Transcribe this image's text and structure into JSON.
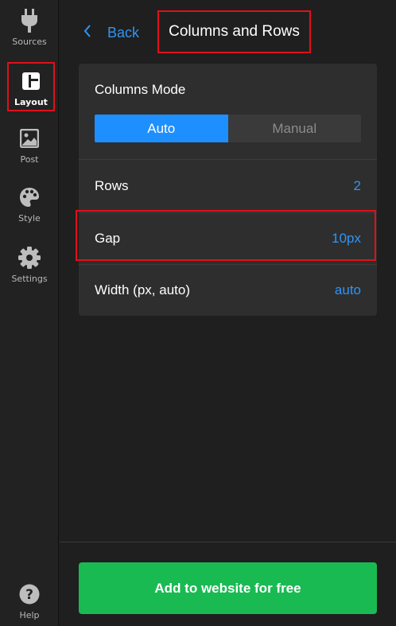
{
  "sidebar": {
    "items": [
      {
        "label": "Sources",
        "icon": "plug-icon"
      },
      {
        "label": "Layout",
        "icon": "layout-icon",
        "active": true
      },
      {
        "label": "Post",
        "icon": "image-icon"
      },
      {
        "label": "Style",
        "icon": "palette-icon"
      },
      {
        "label": "Settings",
        "icon": "gear-icon"
      }
    ],
    "help_label": "Help"
  },
  "header": {
    "back_label": "Back",
    "title": "Columns and Rows"
  },
  "columns_mode": {
    "title": "Columns Mode",
    "options": [
      "Auto",
      "Manual"
    ],
    "selected": "Auto"
  },
  "settings": {
    "rows": {
      "label": "Rows",
      "value": "2"
    },
    "gap": {
      "label": "Gap",
      "value": "10px"
    },
    "width": {
      "label": "Width (px, auto)",
      "value": "auto"
    }
  },
  "cta_label": "Add to website for free",
  "colors": {
    "accent": "#1e8fff",
    "link": "#2f95f5",
    "cta": "#1aba52",
    "highlight": "#e0101a"
  }
}
